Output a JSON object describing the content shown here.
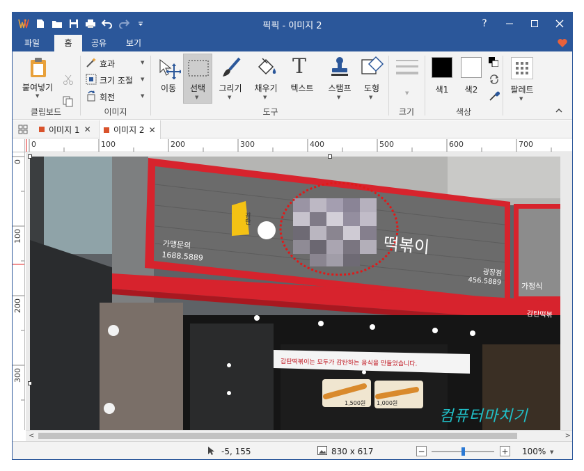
{
  "app": {
    "title": "픽픽 - 이미지 2"
  },
  "menu": {
    "tabs": [
      "파일",
      "홈",
      "공유",
      "보기"
    ],
    "active": "홈"
  },
  "ribbon": {
    "clipboard": {
      "paste": "붙여넣기",
      "group": "클립보드"
    },
    "image": {
      "effect": "효과",
      "resize": "크기 조절",
      "rotate": "회전",
      "group": "이미지"
    },
    "tools": {
      "move": "이동",
      "select": "선택",
      "draw": "그리기",
      "fill": "채우기",
      "text": "텍스트",
      "stamp": "스탬프",
      "shape": "도형",
      "group": "도구"
    },
    "size": {
      "group": "크기"
    },
    "color": {
      "color1": "색1",
      "color2": "색2",
      "group": "색상",
      "color1_value": "#000000",
      "color2_value": "#ffffff"
    },
    "palette": {
      "label": "팔레트"
    }
  },
  "doctabs": [
    {
      "label": "이미지 1"
    },
    {
      "label": "이미지 2"
    }
  ],
  "ruler": {
    "h_ticks": [
      "0",
      "100",
      "200",
      "300",
      "400",
      "500",
      "600",
      "700"
    ],
    "v_ticks": [
      "0",
      "100",
      "200",
      "300"
    ]
  },
  "photo": {
    "sign_left_line1": "가맹문의",
    "sign_left_line2": "1688.5889",
    "sign_main": "떡볶이",
    "sign_right_line1": "광장점",
    "sign_right_line2": "456.5889",
    "logo_text": "감탄",
    "awning_text": "감탄떡볶",
    "side_sign": "가정식",
    "banner_text": "감탄떡볶이는 모두가 감탄하는 음식을 만들었습니다.",
    "price1": "1,500원",
    "price2": "1,000원",
    "watermark": "컴퓨터마치기"
  },
  "status": {
    "cursor": "-5, 155",
    "size": "830 x 617",
    "zoom": "100%",
    "zoom_level": 0.5
  },
  "colors": {
    "accent": "#2b579a",
    "tab_marker": "#d9532c",
    "heart": "#e8613b"
  }
}
